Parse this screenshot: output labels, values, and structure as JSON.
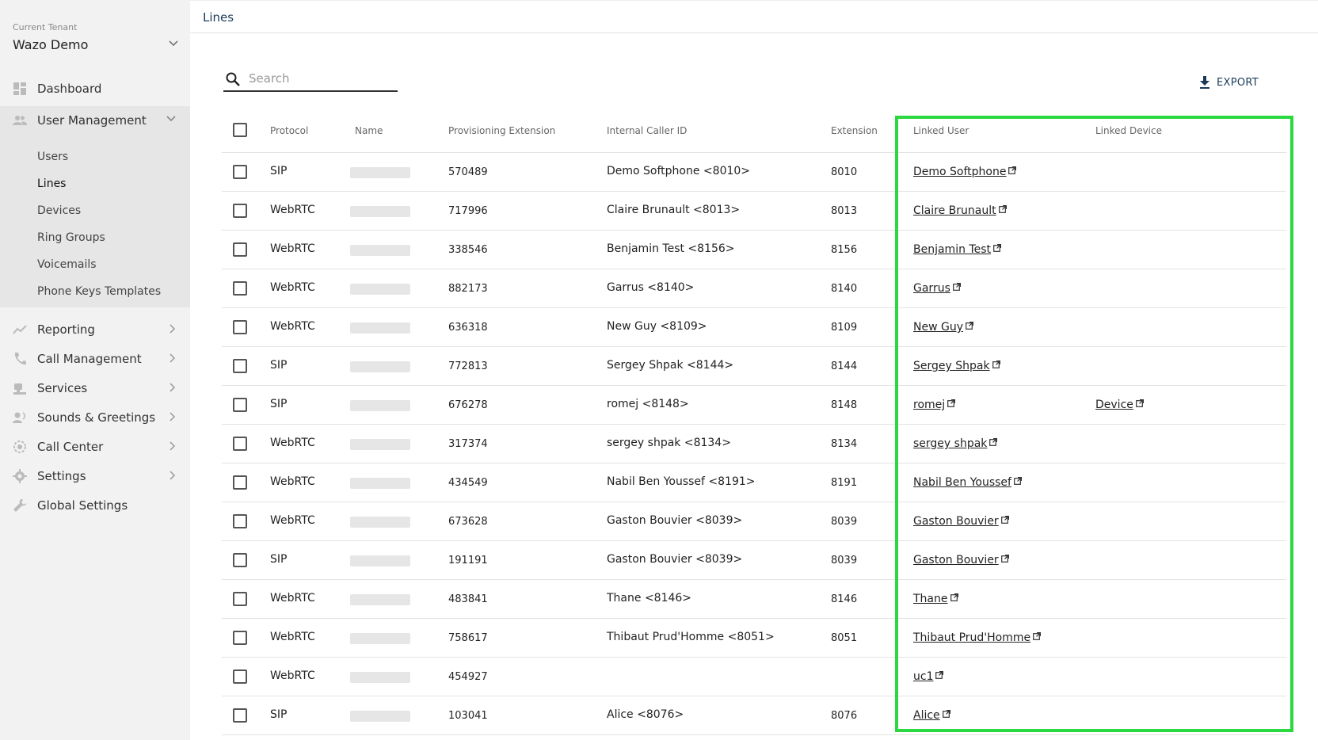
{
  "sidebar": {
    "tenant_label": "Current Tenant",
    "tenant_name": "Wazo Demo",
    "items": [
      {
        "label": "Dashboard",
        "icon": "dashboard-icon"
      },
      {
        "label": "User Management",
        "icon": "users-icon"
      },
      {
        "label": "Reporting",
        "icon": "chart-icon"
      },
      {
        "label": "Call Management",
        "icon": "phone-icon"
      },
      {
        "label": "Services",
        "icon": "services-icon"
      },
      {
        "label": "Sounds & Greetings",
        "icon": "sound-icon"
      },
      {
        "label": "Call Center",
        "icon": "headset-icon"
      },
      {
        "label": "Settings",
        "icon": "gear-icon"
      },
      {
        "label": "Global Settings",
        "icon": "wrench-icon"
      }
    ],
    "sub_items": [
      "Users",
      "Lines",
      "Devices",
      "Ring Groups",
      "Voicemails",
      "Phone Keys Templates"
    ],
    "active_sub": "Lines"
  },
  "header": {
    "title": "Lines"
  },
  "search": {
    "placeholder": "Search",
    "value": ""
  },
  "export_label": "EXPORT",
  "table": {
    "columns": [
      "Protocol",
      "Name",
      "Provisioning Extension",
      "Internal Caller ID",
      "Extension",
      "Linked User",
      "Linked Device"
    ],
    "rows": [
      {
        "protocol": "SIP",
        "prov": "570489",
        "caller_id": "Demo Softphone <8010>",
        "ext": "8010",
        "user": "Demo Softphone",
        "device": ""
      },
      {
        "protocol": "WebRTC",
        "prov": "717996",
        "caller_id": "Claire Brunault <8013>",
        "ext": "8013",
        "user": "Claire Brunault",
        "device": ""
      },
      {
        "protocol": "WebRTC",
        "prov": "338546",
        "caller_id": "Benjamin Test <8156>",
        "ext": "8156",
        "user": "Benjamin Test",
        "device": ""
      },
      {
        "protocol": "WebRTC",
        "prov": "882173",
        "caller_id": "Garrus <8140>",
        "ext": "8140",
        "user": "Garrus",
        "device": ""
      },
      {
        "protocol": "WebRTC",
        "prov": "636318",
        "caller_id": "New Guy <8109>",
        "ext": "8109",
        "user": "New Guy",
        "device": ""
      },
      {
        "protocol": "SIP",
        "prov": "772813",
        "caller_id": "Sergey Shpak <8144>",
        "ext": "8144",
        "user": "Sergey Shpak",
        "device": ""
      },
      {
        "protocol": "SIP",
        "prov": "676278",
        "caller_id": "romej <8148>",
        "ext": "8148",
        "user": "romej",
        "device": "Device"
      },
      {
        "protocol": "WebRTC",
        "prov": "317374",
        "caller_id": "sergey shpak <8134>",
        "ext": "8134",
        "user": "sergey shpak",
        "device": ""
      },
      {
        "protocol": "WebRTC",
        "prov": "434549",
        "caller_id": "Nabil Ben Youssef <8191>",
        "ext": "8191",
        "user": "Nabil Ben Youssef",
        "device": ""
      },
      {
        "protocol": "WebRTC",
        "prov": "673628",
        "caller_id": "Gaston Bouvier <8039>",
        "ext": "8039",
        "user": "Gaston Bouvier",
        "device": ""
      },
      {
        "protocol": "SIP",
        "prov": "191191",
        "caller_id": "Gaston Bouvier <8039>",
        "ext": "8039",
        "user": "Gaston Bouvier",
        "device": ""
      },
      {
        "protocol": "WebRTC",
        "prov": "483841",
        "caller_id": "Thane <8146>",
        "ext": "8146",
        "user": "Thane",
        "device": ""
      },
      {
        "protocol": "WebRTC",
        "prov": "758617",
        "caller_id": "Thibaut Prud'Homme <8051>",
        "ext": "8051",
        "user": "Thibaut Prud'Homme",
        "device": ""
      },
      {
        "protocol": "WebRTC",
        "prov": "454927",
        "caller_id": "",
        "ext": "",
        "user": "uc1",
        "device": ""
      },
      {
        "protocol": "SIP",
        "prov": "103041",
        "caller_id": "Alice <8076>",
        "ext": "8076",
        "user": "Alice",
        "device": ""
      }
    ]
  },
  "colors": {
    "highlight": "#2bd83f",
    "accent": "#1a3a5a"
  }
}
